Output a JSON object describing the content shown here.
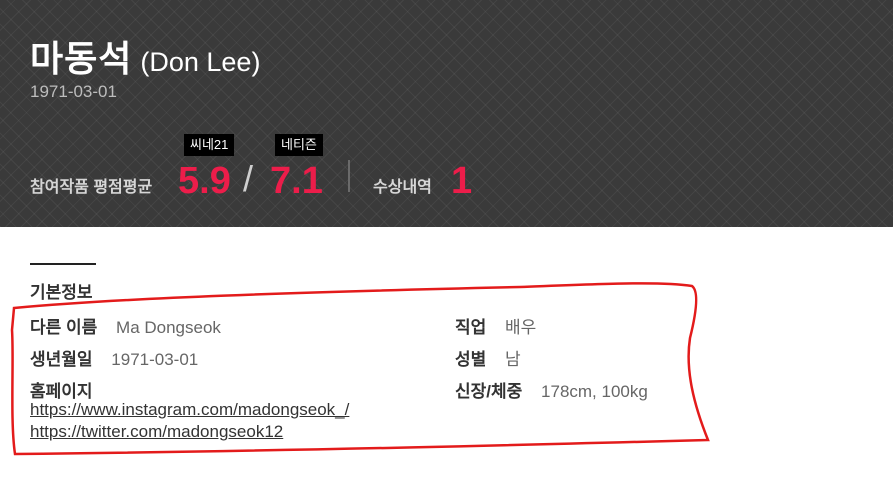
{
  "profile": {
    "name_ko": "마동석",
    "name_en": "(Don Lee)",
    "birthdate": "1971-03-01"
  },
  "scores": {
    "label": "참여작품 평점평균",
    "cine21_label": "씨네21",
    "cine21_score": "5.9",
    "separator": "/",
    "netizen_label": "네티즌",
    "netizen_score": "7.1",
    "award_label": "수상내역",
    "award_count": "1"
  },
  "basic_info": {
    "title": "기본정보",
    "other_name_label": "다른 이름",
    "other_name_value": "Ma Dongseok",
    "job_label": "직업",
    "job_value": "배우",
    "birth_label": "생년월일",
    "birth_value": "1971-03-01",
    "gender_label": "성별",
    "gender_value": "남",
    "homepage_label": "홈페이지",
    "body_label": "신장/체중",
    "body_value": "178cm, 100kg",
    "homepages": [
      "https://www.instagram.com/madongseok_/",
      "https://twitter.com/madongseok12"
    ]
  },
  "annotation": {
    "color": "#e31b1b"
  }
}
